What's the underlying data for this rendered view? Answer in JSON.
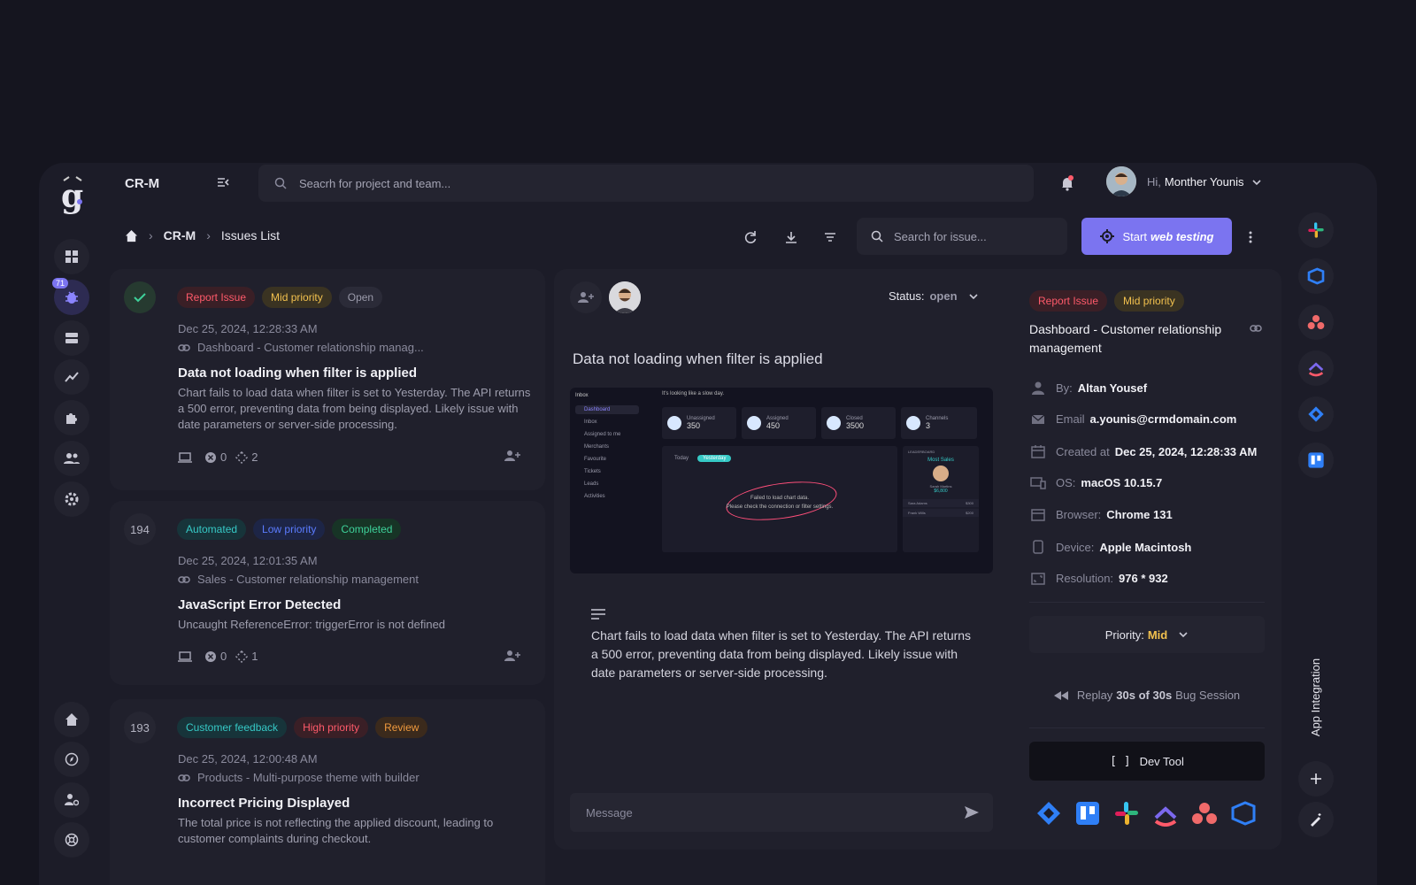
{
  "header": {
    "project": "CR-M",
    "search_placeholder": "Seacrh for project and team...",
    "greeting": "Hi,",
    "user_name": "Monther Younis"
  },
  "sidebar": {
    "badge": "71"
  },
  "breadcrumb": {
    "project": "CR-M",
    "page": "Issues List"
  },
  "toolbar": {
    "search_placeholder": "Search for issue...",
    "start_label": "Start",
    "start_emph": "web testing"
  },
  "issues": [
    {
      "number": "",
      "tags": [
        "Report Issue",
        "Mid priority",
        "Open"
      ],
      "date": "Dec 25, 2024, 12:28:33 AM",
      "link": "Dashboard - Customer relationship manag...",
      "title": "Data not loading when filter is applied",
      "desc": "Chart fails to load data when filter is set to Yesterday. The API returns a 500 error, preventing data from being displayed. Likely issue with date parameters or server-side processing.",
      "errors": "0",
      "steps": "2"
    },
    {
      "number": "194",
      "tags": [
        "Automated",
        "Low priority",
        "Completed"
      ],
      "date": "Dec 25, 2024, 12:01:35 AM",
      "link": "Sales - Customer relationship management",
      "title": "JavaScript Error Detected",
      "desc": "Uncaught ReferenceError: triggerError is not defined",
      "errors": "0",
      "steps": "1"
    },
    {
      "number": "193",
      "tags": [
        "Customer feedback",
        "High priority",
        "Review"
      ],
      "date": "Dec 25, 2024, 12:00:48 AM",
      "link": "Products - Multi-purpose theme with builder",
      "title": "Incorrect Pricing Displayed",
      "desc": "The total price is not reflecting the applied discount, leading to customer complaints during checkout."
    }
  ],
  "detail": {
    "status_label": "Status:",
    "status_value": "open",
    "title": "Data not loading when filter is applied",
    "description": "Chart fails to load data when filter is set to Yesterday. The API returns a 500 error, preventing data from being displayed. Likely issue with date parameters or server-side processing.",
    "message_placeholder": "Message",
    "screenshot": {
      "brand": "Inbox",
      "greeting": "It's looking like a slow day.",
      "nav": [
        "Dashboard",
        "Inbox",
        "Assigned to me",
        "Merchants",
        "Favourite",
        "Tickets",
        "Leads",
        "Activities"
      ],
      "stats": [
        {
          "label": "Unassigned",
          "value": "350"
        },
        {
          "label": "Assigned",
          "value": "450"
        },
        {
          "label": "Closed",
          "value": "3500"
        },
        {
          "label": "Channels",
          "value": "3"
        }
      ],
      "tab_today": "Today",
      "tab_yesterday": "Yesterday",
      "error_line1": "Failed to load chart data.",
      "error_line2": "Please check the connection or filter settings.",
      "leaderboard": "LEADERBOARD",
      "most_sales": "Most Sales",
      "leader_name": "Sarah Martins",
      "leader_value": "$6,800",
      "rows": [
        {
          "name": "Sara Adams",
          "value": "$300"
        },
        {
          "name": "Frank Wills",
          "value": "$200"
        }
      ]
    }
  },
  "info": {
    "tags": [
      "Report Issue",
      "Mid priority"
    ],
    "page": "Dashboard - Customer relationship management",
    "by_label": "By:",
    "by_value": "Altan Yousef",
    "email_label": "Email",
    "email_value": "a.younis@crmdomain.com",
    "created_label": "Created at",
    "created_value": "Dec 25, 2024, 12:28:33 AM",
    "os_label": "OS:",
    "os_value": "macOS 10.15.7",
    "browser_label": "Browser:",
    "browser_value": "Chrome 131",
    "device_label": "Device:",
    "device_value": "Apple Macintosh",
    "resolution_label": "Resolution:",
    "resolution_value": "976 * 932",
    "priority_label": "Priority:",
    "priority_value": "Mid",
    "replay_pre": "Replay",
    "replay_emph": "30s of 30s",
    "replay_post": "Bug Session",
    "devtool_label": "Dev Tool"
  },
  "integration": {
    "label": "App Integration"
  },
  "colors": {
    "accent": "#7b74f0",
    "bg": "#15151f",
    "panel": "#1c1c28",
    "card": "#20202c",
    "warn": "#f2c14e"
  }
}
